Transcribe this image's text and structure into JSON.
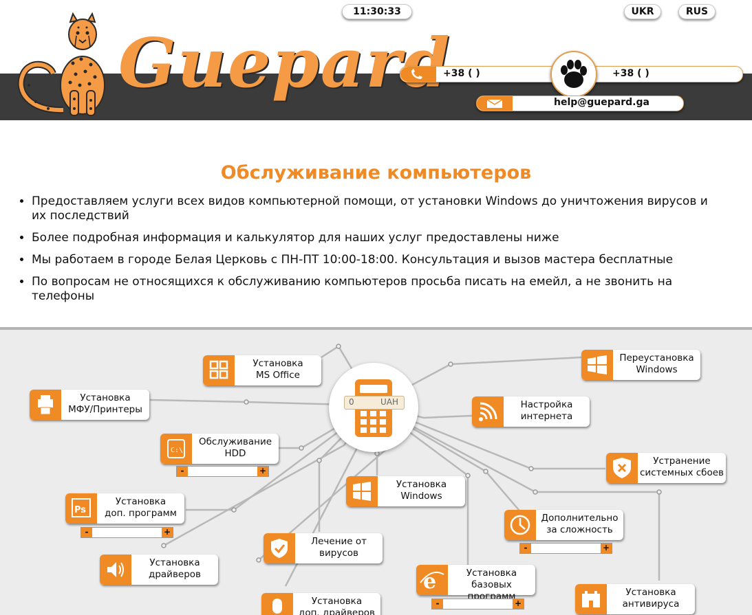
{
  "header": {
    "clock": "11:30:33",
    "lang_ukr": "UKR",
    "lang_rus": "RUS",
    "logo_text": "Guepard",
    "phone1": "+38 (      )",
    "phone2": "+38 (      )",
    "email": "help@guepard.ga"
  },
  "intro": {
    "title": "Обслуживание компьютеров",
    "bullets": [
      "Предоставляем услуги всех видов компьютерной помощи, от установки Windows до уничтожения вирусов и их последствий",
      "Более подробная информация и калькулятор для наших услуг предоставлены ниже",
      "Мы работаем в городе Белая Церковь с ПН-ПТ 10:00-18:00. Консультация и вызов мастера бесплатные",
      "По вопросам не относящихся к обслуживанию компьютеров просьба писать на емейл, а не звонить на телефоны"
    ]
  },
  "calculator": {
    "total_value": "0",
    "currency": "UAH",
    "minus": "-",
    "plus": "+",
    "services": {
      "office": [
        "Установка",
        "MS Office"
      ],
      "printers": [
        "Установка",
        "МФУ/Принтеры"
      ],
      "hdd": [
        "Обслуживание",
        "HDD"
      ],
      "addprog": [
        "Установка",
        "доп. программ"
      ],
      "drivers": [
        "Установка",
        "драйверов"
      ],
      "adddrivers": [
        "Установка",
        "доп. драйверов"
      ],
      "windows": [
        "Установка",
        "Windows"
      ],
      "virus": [
        "Лечение от",
        "вирусов"
      ],
      "baseprog": [
        "Установка",
        "базовых программ"
      ],
      "reinstall": [
        "Переустановка",
        "Windows"
      ],
      "internet": [
        "Настройка",
        "интернета"
      ],
      "sysfix": [
        "Устранение",
        "системных сбоев"
      ],
      "complexity": [
        "Дополнительно",
        "за сложность"
      ],
      "antivirus": [
        "Установка",
        "антивируса"
      ]
    }
  },
  "colors": {
    "accent": "#f08a24",
    "dark_band": "#3b3b3b",
    "calc_bg": "#ececec"
  }
}
